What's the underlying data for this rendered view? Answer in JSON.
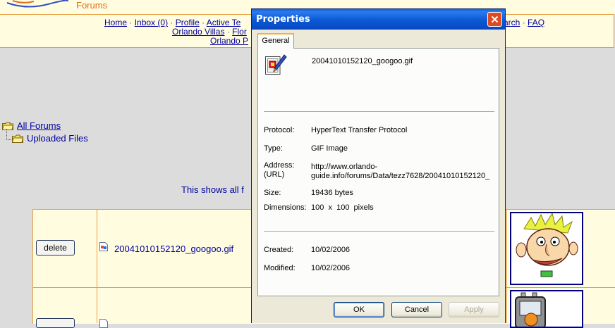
{
  "forum": {
    "title": "Forums",
    "nav_line1": [
      "Home",
      "Inbox (0)",
      "Profile",
      "Active Te"
    ],
    "nav_line1_right": [
      "arch",
      "FAQ"
    ],
    "nav_line2": [
      "Orlando Villas",
      "Flor"
    ],
    "nav_line3": "Orlando P",
    "tree": {
      "root": "All Forums",
      "child": "Uploaded Files"
    },
    "info_text": "This shows all f",
    "rows": [
      {
        "action_label": "delete",
        "file_name": "20041010152120_googoo.gif"
      },
      {
        "action_label": "",
        "file_name": ""
      }
    ]
  },
  "dialog": {
    "title": "Properties",
    "tab_label": "General",
    "file_name": "20041010152120_googoo.gif",
    "fields": {
      "protocol_label": "Protocol:",
      "protocol_value": "HyperText Transfer Protocol",
      "type_label": "Type:",
      "type_value": "GIF Image",
      "address_label_1": "Address:",
      "address_label_2": "(URL)",
      "address_value_1": "http://www.orlando-",
      "address_value_2": "guide.info/forums/Data/tezz7628/20041010152120_",
      "size_label": "Size:",
      "size_value": "19436 bytes",
      "dimensions_label": "Dimensions:",
      "dimensions_value": "100  x  100  pixels",
      "created_label": "Created:",
      "created_value": "10/02/2006",
      "modified_label": "Modified:",
      "modified_value": "10/02/2006"
    },
    "buttons": {
      "ok": "OK",
      "cancel": "Cancel",
      "apply": "Apply"
    }
  },
  "colors": {
    "titlebar": "#0a5fd8",
    "link": "#0000a0",
    "forum_bg": "#fffce0",
    "forum_border": "#e8a040"
  }
}
